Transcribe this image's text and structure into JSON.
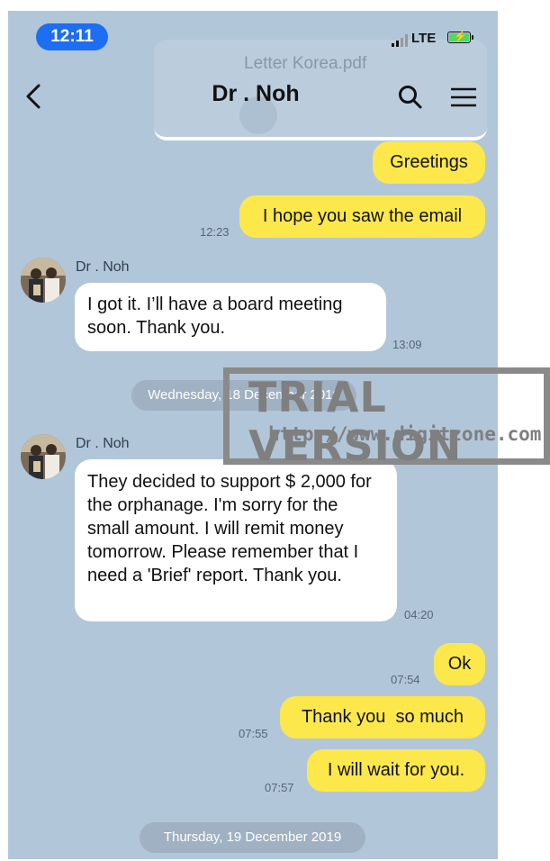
{
  "status_bar": {
    "time": "12:11",
    "network": "LTE"
  },
  "header": {
    "title": "Dr . Noh"
  },
  "ghost_attachment": {
    "file_name": "Letter Korea.pdf"
  },
  "messages": [
    {
      "side": "me",
      "text": "Greetings",
      "time": ""
    },
    {
      "side": "me",
      "text": "I hope you saw the email",
      "time": "12:23"
    },
    {
      "side": "them",
      "sender": "Dr . Noh",
      "text": "I got it. I’ll have a board meeting soon. Thank you.",
      "time": "13:09"
    },
    {
      "side": "them",
      "sender": "Dr . Noh",
      "text": "They decided to support $ 2,000 for the orphanage. I'm sorry for the small amount. I will remit money tomorrow. Please remember that I need a 'Brief' report. Thank you.",
      "time": "04:20"
    },
    {
      "side": "me",
      "text": "Ok",
      "time": "07:54"
    },
    {
      "side": "me",
      "text": "Thank you  so much",
      "time": "07:55"
    },
    {
      "side": "me",
      "text": "I will wait for you.",
      "time": "07:57"
    }
  ],
  "date_separators": [
    "Wednesday, 18 December 2019",
    "Thursday, 19 December 2019"
  ],
  "watermark": {
    "line1": "TRIAL VERSION",
    "line2": "http://www.digitzone.com"
  },
  "colors": {
    "background": "#b2c6d9",
    "my_bubble": "#fde84c",
    "their_bubble": "#ffffff",
    "time_pill": "#1d6ef2"
  }
}
